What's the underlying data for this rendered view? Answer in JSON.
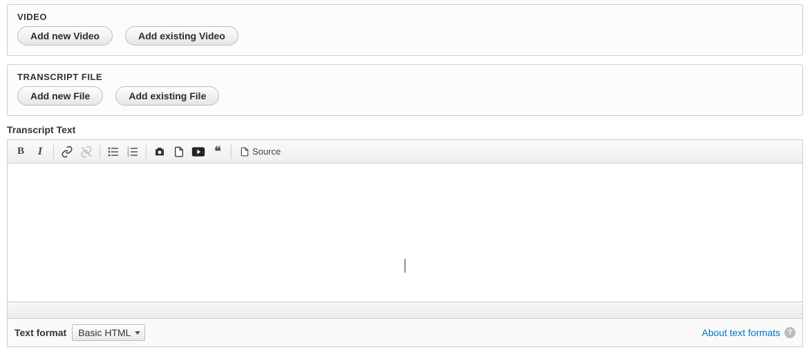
{
  "video_section": {
    "heading": "VIDEO",
    "add_new": "Add new Video",
    "add_existing": "Add existing Video"
  },
  "transcript_file_section": {
    "heading": "TRANSCRIPT FILE",
    "add_new": "Add new File",
    "add_existing": "Add existing File"
  },
  "transcript_text": {
    "label": "Transcript Text",
    "value": "",
    "toolbar": {
      "source_label": "Source"
    }
  },
  "text_format": {
    "label": "Text format",
    "selected": "Basic HTML",
    "about_link": "About text formats"
  }
}
